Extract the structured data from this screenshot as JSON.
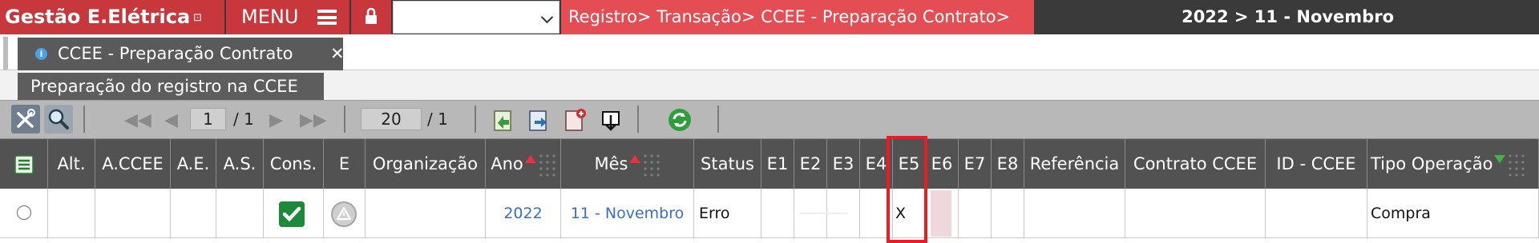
{
  "header": {
    "app_title": "Gestão E.Elétrica",
    "app_title_glyph": "⊡",
    "menu_label": "MENU",
    "breadcrumb": "Registro> Transação> CCEE - Preparação Contrato>",
    "period": "2022 > 11 - Novembro"
  },
  "tabs": {
    "main": {
      "label": "CCEE - Preparação Contrato",
      "info": "i",
      "close": "✕"
    },
    "sub": {
      "label": "Preparação do registro na CCEE"
    }
  },
  "toolbar": {
    "page_current": "1",
    "page_total": "/ 1",
    "rows_per_page": "20",
    "rows_total": "/ 1"
  },
  "table": {
    "columns": [
      "Alt.",
      "A.CCEE",
      "A.E.",
      "A.S.",
      "Cons.",
      "E",
      "Organização",
      "Ano",
      "Mês",
      "Status",
      "E1",
      "E2",
      "E3",
      "E4",
      "E5",
      "E6",
      "E7",
      "E8",
      "Referência",
      "Contrato CCEE",
      "ID - CCEE",
      "Tipo Operação"
    ],
    "sorted": {
      "Ano": "asc",
      "Mês": "asc",
      "Tipo Operação": "desc"
    },
    "rows": [
      {
        "ano": "2022",
        "mes": "11 - Novembro",
        "status": "Erro",
        "e5": "X",
        "tipo_operacao": "Compra",
        "consolidated": true
      }
    ]
  },
  "colors": {
    "brand_red": "#c8373b",
    "breadcrumb_red": "#e34d53",
    "header_dark": "#3a3a3a",
    "grid_header": "#525252",
    "link_blue": "#3a6ec2",
    "highlight_red": "#ec1c24"
  },
  "icons": [
    "lock-icon",
    "chevron-down-icon",
    "tools-icon",
    "search-icon",
    "first-page-icon",
    "prev-page-icon",
    "next-page-icon",
    "last-page-icon",
    "import-icon",
    "export-icon",
    "pdf-report-icon",
    "download-icon",
    "refresh-icon",
    "column-config-icon",
    "edit-icon",
    "check-icon",
    "warning-icon"
  ]
}
